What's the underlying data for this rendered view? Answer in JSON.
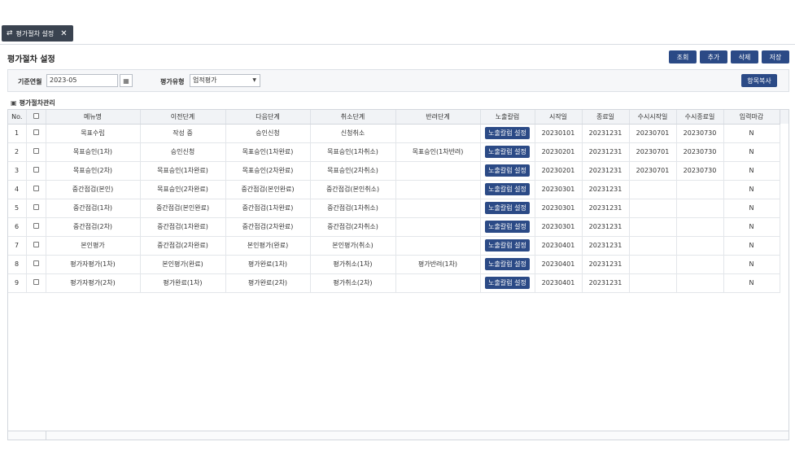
{
  "tab": {
    "icon": "sliders-icon",
    "label": "평가절차 설정",
    "close": "✕"
  },
  "page": {
    "title": "평가절차 설정"
  },
  "toolbar": {
    "search": "조회",
    "add": "추가",
    "delete": "삭제",
    "save": "저장"
  },
  "filters": {
    "base_month_label": "기준연월",
    "base_month_value": "2023-05",
    "eval_type_label": "평가유형",
    "eval_type_value": "업적평가",
    "copy_label": "항목복사"
  },
  "grid": {
    "title": "평가절차관리",
    "headers": [
      "No.",
      "",
      "메뉴명",
      "이전단계",
      "다음단계",
      "취소단계",
      "반려단계",
      "노출칼럼",
      "시작일",
      "종료일",
      "수시시작일",
      "수시종료일",
      "입력마감"
    ],
    "button_label": "노출칼럼 설정",
    "rows": [
      {
        "no": "1",
        "menu": "목표수립",
        "prev": "작성 중",
        "next": "승인신청",
        "cancel": "신청취소",
        "reject": "",
        "start": "20230101",
        "end": "20231231",
        "adhoc_start": "20230701",
        "adhoc_end": "20230730",
        "deadline": "N"
      },
      {
        "no": "2",
        "menu": "목표승인(1차)",
        "prev": "승인신청",
        "next": "목표승인(1차완료)",
        "cancel": "목표승인(1차취소)",
        "reject": "목표승인(1차반려)",
        "start": "20230201",
        "end": "20231231",
        "adhoc_start": "20230701",
        "adhoc_end": "20230730",
        "deadline": "N"
      },
      {
        "no": "3",
        "menu": "목표승인(2차)",
        "prev": "목표승인(1차완료)",
        "next": "목표승인(2차완료)",
        "cancel": "목표승인(2차취소)",
        "reject": "",
        "start": "20230201",
        "end": "20231231",
        "adhoc_start": "20230701",
        "adhoc_end": "20230730",
        "deadline": "N"
      },
      {
        "no": "4",
        "menu": "중간점검(본인)",
        "prev": "목표승인(2차완료)",
        "next": "중간점검(본인완료)",
        "cancel": "중간점검(본인취소)",
        "reject": "",
        "start": "20230301",
        "end": "20231231",
        "adhoc_start": "",
        "adhoc_end": "",
        "deadline": "N"
      },
      {
        "no": "5",
        "menu": "중간점검(1차)",
        "prev": "중간점검(본인완료)",
        "next": "중간점검(1차완료)",
        "cancel": "중간점검(1차취소)",
        "reject": "",
        "start": "20230301",
        "end": "20231231",
        "adhoc_start": "",
        "adhoc_end": "",
        "deadline": "N"
      },
      {
        "no": "6",
        "menu": "중간점검(2차)",
        "prev": "중간점검(1차완료)",
        "next": "중간점검(2차완료)",
        "cancel": "중간점검(2차취소)",
        "reject": "",
        "start": "20230301",
        "end": "20231231",
        "adhoc_start": "",
        "adhoc_end": "",
        "deadline": "N"
      },
      {
        "no": "7",
        "menu": "본인평가",
        "prev": "중간점검(2차완료)",
        "next": "본인평가(완료)",
        "cancel": "본인평가(취소)",
        "reject": "",
        "start": "20230401",
        "end": "20231231",
        "adhoc_start": "",
        "adhoc_end": "",
        "deadline": "N"
      },
      {
        "no": "8",
        "menu": "평가자평가(1차)",
        "prev": "본인평가(완료)",
        "next": "평가완료(1차)",
        "cancel": "평가취소(1차)",
        "reject": "평가반려(1차)",
        "start": "20230401",
        "end": "20231231",
        "adhoc_start": "",
        "adhoc_end": "",
        "deadline": "N"
      },
      {
        "no": "9",
        "menu": "평가자평가(2차)",
        "prev": "평가완료(1차)",
        "next": "평가완료(2차)",
        "cancel": "평가취소(2차)",
        "reject": "",
        "start": "20230401",
        "end": "20231231",
        "adhoc_start": "",
        "adhoc_end": "",
        "deadline": "N"
      }
    ]
  },
  "colors": {
    "primary_button": "#2b4a86",
    "tab_bg": "#3a4350",
    "header_bg": "#f1f3f6"
  }
}
